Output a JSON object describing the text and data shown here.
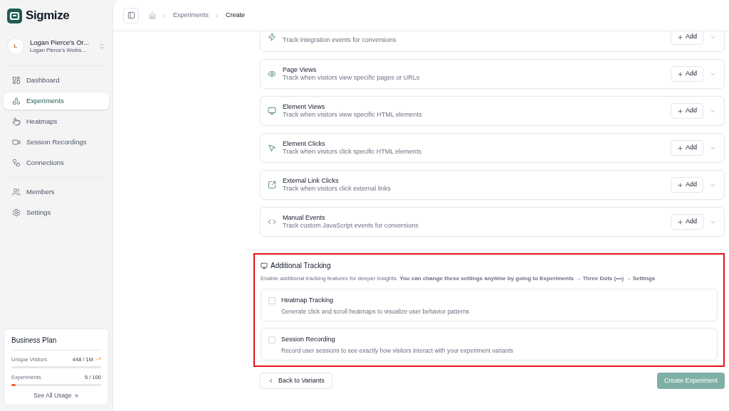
{
  "brand": {
    "name": "Sigmize"
  },
  "org": {
    "initial": "L",
    "name": "Logan Pierce's Or...",
    "workspace": "Logan Pierce's Works..."
  },
  "nav": [
    {
      "label": "Dashboard",
      "selected": false
    },
    {
      "label": "Experiments",
      "selected": true
    },
    {
      "label": "Heatmaps",
      "selected": false
    },
    {
      "label": "Session Recordings",
      "selected": false
    },
    {
      "label": "Connections",
      "selected": false
    },
    {
      "label": "Members",
      "selected": false
    },
    {
      "label": "Settings",
      "selected": false
    }
  ],
  "plan": {
    "title": "Business Plan",
    "meters": [
      {
        "label": "Unique Visitors",
        "reading": "448 / 1M"
      },
      {
        "label": "Experiments",
        "reading": "5 / 100",
        "level": 0.05
      }
    ],
    "link": "See All Usage"
  },
  "breadcrumbs": [
    "Experiments",
    "Create"
  ],
  "goals": [
    {
      "description": "Track integration events for conversions",
      "button": "Add"
    },
    {
      "title": "Page Views",
      "description": "Track when visitors view specific pages or URLs",
      "button": "Add"
    },
    {
      "title": "Element Views",
      "description": "Track when visitors view specific HTML elements",
      "button": "Add"
    },
    {
      "title": "Element Clicks",
      "description": "Track when visitors click specific HTML elements",
      "button": "Add"
    },
    {
      "title": "External Link Clicks",
      "description": "Track when visitors click external links",
      "button": "Add"
    },
    {
      "title": "Manual Events",
      "description": "Track custom JavaScript events for conversions",
      "button": "Add"
    }
  ],
  "additional": {
    "title": "Additional Tracking",
    "highlighted": true,
    "description": "Enable additional tracking features for deeper insights. **You can change these settings anytime by going to Experiments → Three Dots (•••) → Settings**",
    "options": [
      {
        "title": "Heatmap Tracking",
        "description": "Generate click and scroll heatmaps to visualize user behavior patterns",
        "checked": false
      },
      {
        "title": "Session Recording",
        "description": "Record user sessions to see exactly how visitors interact with your experiment variants",
        "checked": false
      }
    ]
  },
  "footer": {
    "back": "Back to Variants",
    "create": "Create Experiment",
    "create_disabled": true
  }
}
